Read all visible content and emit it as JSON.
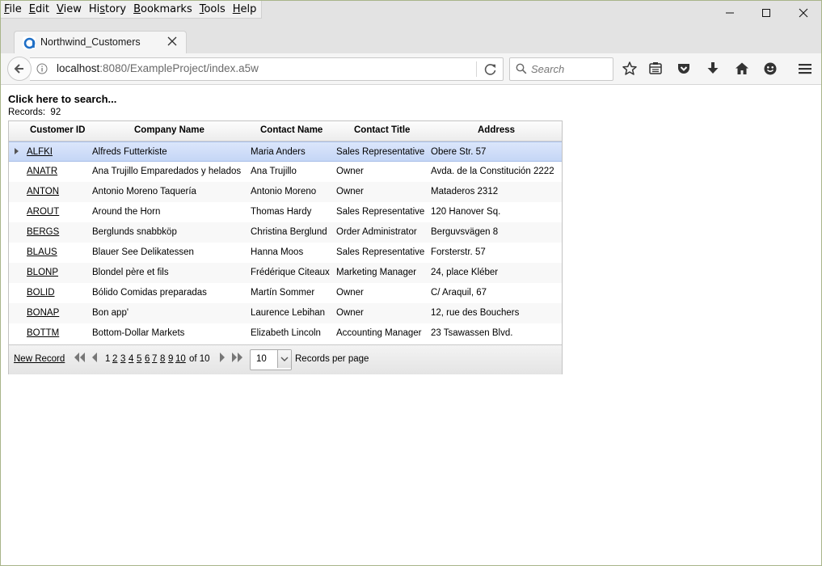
{
  "menu": {
    "items": [
      {
        "first": "F",
        "rest": "ile"
      },
      {
        "first": "E",
        "rest": "dit"
      },
      {
        "first": "V",
        "rest": "iew"
      },
      {
        "first": "Hi",
        "rest": "story",
        "underline_index": 1
      },
      {
        "first": "B",
        "rest": "ookmarks"
      },
      {
        "first": "T",
        "rest": "ools"
      },
      {
        "first": "H",
        "rest": "elp"
      }
    ]
  },
  "tab": {
    "title": "Northwind_Customers",
    "icon": "alpha-anywhere-icon"
  },
  "navbar": {
    "url_host": "localhost",
    "url_rest": ":8080/ExampleProject/index.a5w",
    "search_placeholder": "Search"
  },
  "page": {
    "search_link": "Click here to search...",
    "records_label": "Records:",
    "records_count": "92"
  },
  "grid": {
    "columns": [
      "Customer ID",
      "Company Name",
      "Contact Name",
      "Contact Title",
      "Address"
    ],
    "rows": [
      [
        "ALFKI",
        "Alfreds Futterkiste",
        "Maria Anders",
        "Sales Representative",
        "Obere Str. 57"
      ],
      [
        "ANATR",
        "Ana Trujillo Emparedados y helados",
        "Ana Trujillo",
        "Owner",
        "Avda. de la Constitución 2222"
      ],
      [
        "ANTON",
        "Antonio Moreno Taquería",
        "Antonio Moreno",
        "Owner",
        "Mataderos 2312"
      ],
      [
        "AROUT",
        "Around the Horn",
        "Thomas Hardy",
        "Sales Representative",
        "120 Hanover Sq."
      ],
      [
        "BERGS",
        "Berglunds snabbköp",
        "Christina Berglund",
        "Order Administrator",
        "Berguvsvägen 8"
      ],
      [
        "BLAUS",
        "Blauer See Delikatessen",
        "Hanna Moos",
        "Sales Representative",
        "Forsterstr. 57"
      ],
      [
        "BLONP",
        "Blondel père et fils",
        "Frédérique Citeaux",
        "Marketing Manager",
        "24, place Kléber"
      ],
      [
        "BOLID",
        "Bólido Comidas preparadas",
        "Martín Sommer",
        "Owner",
        "C/ Araquil, 67"
      ],
      [
        "BONAP",
        "Bon app'",
        "Laurence Lebihan",
        "Owner",
        "12, rue des Bouchers"
      ],
      [
        "BOTTM",
        "Bottom-Dollar Markets",
        "Elizabeth Lincoln",
        "Accounting Manager",
        "23 Tsawassen Blvd."
      ]
    ],
    "selected_row": 0
  },
  "footer": {
    "new_record": "New Record",
    "pages": [
      "1",
      "2",
      "3",
      "4",
      "5",
      "6",
      "7",
      "8",
      "9",
      "10"
    ],
    "current_page": "1",
    "of_text": "of 10",
    "page_size": "10",
    "records_per_page": "Records per page"
  }
}
